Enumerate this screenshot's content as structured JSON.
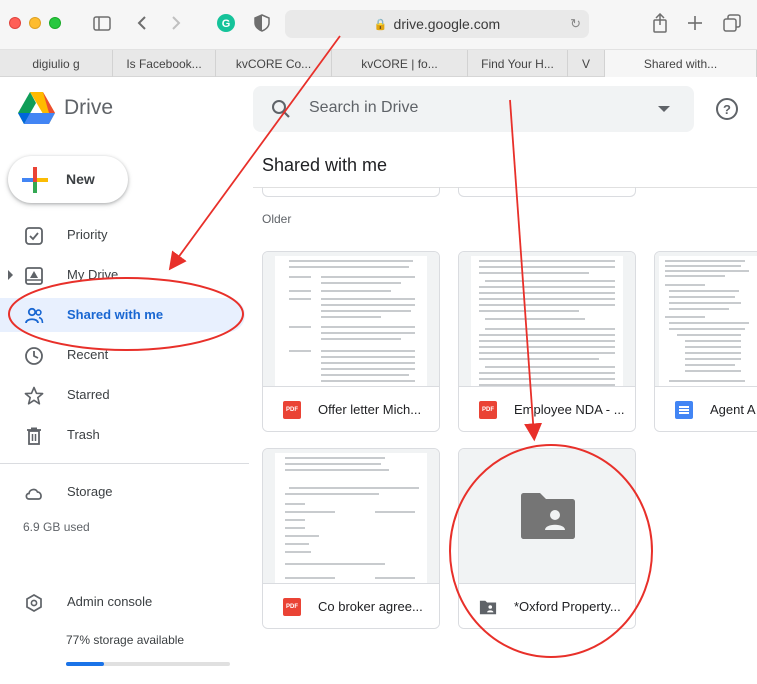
{
  "browser": {
    "url": "drive.google.com",
    "tabs": [
      "digiulio g",
      "Is Facebook...",
      "kvCORE Co...",
      "kvCORE | fo...",
      "Find Your H...",
      "V",
      "Shared with..."
    ]
  },
  "app": {
    "title": "Drive"
  },
  "search": {
    "placeholder": "Search in Drive"
  },
  "sidebar": {
    "new_label": "New",
    "items": [
      {
        "label": "Priority",
        "icon": "priority-icon"
      },
      {
        "label": "My Drive",
        "icon": "my-drive-icon"
      },
      {
        "label": "Shared with me",
        "icon": "shared-icon"
      },
      {
        "label": "Recent",
        "icon": "clock-icon"
      },
      {
        "label": "Starred",
        "icon": "star-icon"
      },
      {
        "label": "Trash",
        "icon": "trash-icon"
      }
    ],
    "storage": {
      "label": "Storage",
      "used": "6.9 GB used",
      "admin_label": "Admin console",
      "available": "77% storage available",
      "used_fraction": 0.23
    }
  },
  "main": {
    "title": "Shared with me",
    "section": "Older",
    "files": [
      {
        "name": "Offer letter Mich...",
        "type": "pdf"
      },
      {
        "name": "Employee NDA - ...",
        "type": "pdf"
      },
      {
        "name": "Agent A",
        "type": "doc"
      },
      {
        "name": "Co broker agree...",
        "type": "pdf"
      },
      {
        "name": "*Oxford Property...",
        "type": "shared-folder"
      }
    ]
  },
  "colors": {
    "accent": "#1a73e8",
    "active_bg": "#e8f0fe",
    "annotation": "#e8302a"
  }
}
